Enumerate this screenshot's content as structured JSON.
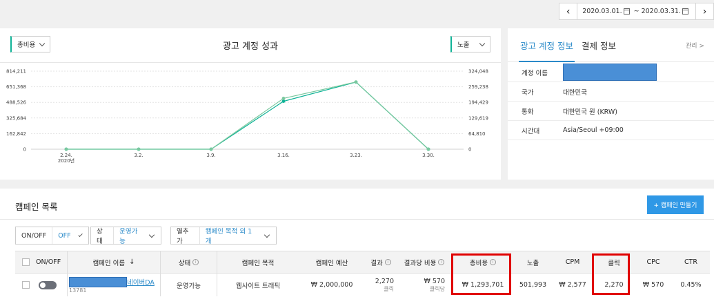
{
  "date_range": {
    "start": "2020.03.01.",
    "separator": "~",
    "end": "2020.03.31."
  },
  "performance": {
    "title": "광고 계정 성과",
    "left_select": "총비용",
    "right_select": "노출"
  },
  "chart_data": {
    "type": "line",
    "categories": [
      "2.24.",
      "3.2.",
      "3.9.",
      "3.16.",
      "3.23.",
      "3.30."
    ],
    "x_sublabel": "2020년",
    "y_left_ticks": [
      "0",
      "162,842",
      "325,684",
      "488,526",
      "651,368",
      "814,211"
    ],
    "y_right_ticks": [
      "0",
      "64,810",
      "129,619",
      "194,429",
      "259,238",
      "324,048"
    ],
    "ylim_left": [
      0,
      814211
    ],
    "ylim_right": [
      0,
      324048
    ],
    "series": [
      {
        "axis": "left",
        "values": [
          0,
          0,
          0,
          500000,
          700000,
          0
        ],
        "color": "#0fb397"
      },
      {
        "axis": "right",
        "values": [
          0,
          0,
          0,
          211000,
          279000,
          0
        ],
        "color": "#7ac89e"
      }
    ],
    "grid": true
  },
  "account": {
    "tabs": [
      "광고 계정 정보",
      "결제 정보"
    ],
    "manage_link": "관리 >",
    "rows": [
      {
        "key": "계정 이름",
        "value": ""
      },
      {
        "key": "국가",
        "value": "대한민국"
      },
      {
        "key": "통화",
        "value": "대한민국 원 (KRW)"
      },
      {
        "key": "시간대",
        "value": "Asia/Seoul +09:00"
      }
    ]
  },
  "campaigns": {
    "title": "캠페인 목록",
    "create_button": "+ 캠페인 만들기",
    "filters": {
      "onoff_label": "ON/OFF",
      "onoff_value": "OFF",
      "status_label": "상태",
      "status_value": "운영가능",
      "columns_label": "열추가",
      "columns_value": "캠페인 목적 외 1 개"
    },
    "headers": {
      "onoff": "ON/OFF",
      "name": "캠페인 이름",
      "sort_arrow": "↓",
      "status": "상태",
      "objective": "캠페인 목적",
      "budget": "캠페인 예산",
      "result": "결과",
      "cost_per_result": "결과당 비용",
      "total_cost": "총비용",
      "impressions": "노출",
      "cpm": "CPM",
      "clicks": "클릭",
      "cpc": "CPC",
      "ctr": "CTR"
    },
    "info_glyph": "i",
    "rows": [
      {
        "name_suffix": "네이버DA",
        "id": "13781",
        "status": "운영가능",
        "objective": "웹사이트 트래픽",
        "budget": "₩ 2,000,000",
        "result": "2,270",
        "result_unit": "클릭",
        "cost_per_result": "₩ 570",
        "cost_per_result_unit": "클릭당",
        "total_cost": "₩ 1,293,701",
        "impressions": "501,993",
        "cpm": "₩ 2,577",
        "clicks": "2,270",
        "cpc": "₩ 570",
        "ctr": "0.45%"
      }
    ]
  }
}
